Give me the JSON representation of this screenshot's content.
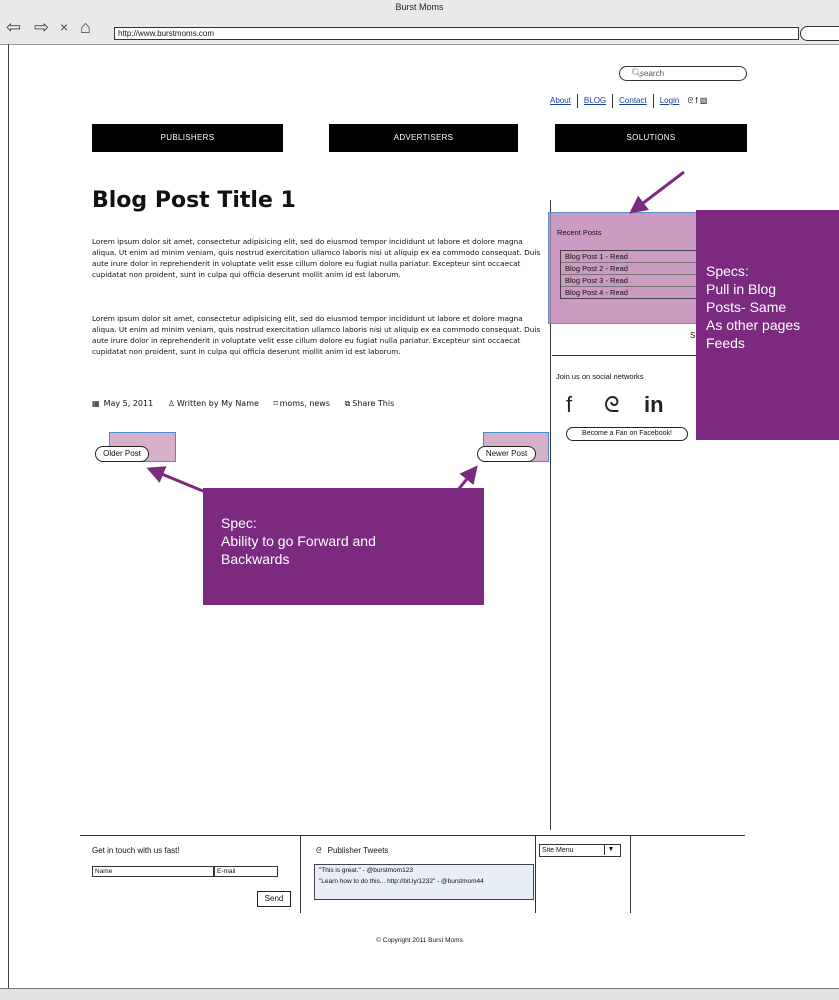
{
  "browser": {
    "window_title": "Burst Moms",
    "url": "http://www.burstmoms.com",
    "nav_back": "⇦",
    "nav_forward": "⇨",
    "nav_close": "×",
    "nav_home": "⌂"
  },
  "header": {
    "search_placeholder": "search",
    "links": {
      "about": "About",
      "blog": "BLOG",
      "contact": "Contact",
      "login": "Login"
    },
    "social_icons": [
      "twitter-icon",
      "facebook-icon",
      "rss-icon"
    ]
  },
  "nav": {
    "publishers": "PUBLISHERS",
    "advertisers": "ADVERTISERS",
    "solutions": "SOLUTIONS"
  },
  "post": {
    "title": "Blog Post Title 1",
    "paragraph1": "Lorem ipsum dolor sit amet, consectetur adipisicing elit, sed do eiusmod tempor incididunt ut labore et dolore magna aliqua. Ut enim ad minim veniam, quis nostrud exercitation ullamco laboris nisi ut aliquip ex ea commodo consequat. Duis aute irure dolor in reprehenderit in voluptate velit esse cillum dolore eu fugiat nulla pariatur. Excepteur sint occaecat cupidatat non proident, sunt in culpa qui officia deserunt mollit anim id est laborum.",
    "paragraph2": "Lorem ipsum dolor sit amet, consectetur adipisicing elit, sed do eiusmod tempor incididunt ut labore et dolore magna aliqua. Ut enim ad minim veniam, quis nostrud exercitation ullamco laboris nisi ut aliquip ex ea commodo consequat. Duis aute irure dolor in reprehenderit in voluptate velit esse cillum dolore eu fugiat nulla pariatur. Excepteur sint occaecat cupidatat non proident, sunt in culpa qui officia deserunt mollit anim id est laborum.",
    "date": "May 5, 2011",
    "author": "Written by My Name",
    "tags": "moms, news",
    "share": "Share This",
    "older": "Older Post",
    "newer": "Newer Post"
  },
  "sidebar": {
    "recent_title": "Recent Posts",
    "recent_posts": [
      "Blog Post 1 - Read",
      "Blog Post 2 - Read",
      "Blog Post 3 - Read",
      "Blog Post 4 - Read"
    ],
    "cut_letter": "S",
    "social_title": "Join us on social networks",
    "fan_button": "Become a Fan on Facebook!"
  },
  "specs": {
    "spec1": [
      "Specs:",
      "Pull in Blog",
      "Posts- Same",
      "As other pages",
      "Feeds"
    ],
    "spec2": [
      "Spec:",
      "Ability to go Forward and",
      "Backwards"
    ]
  },
  "footer": {
    "contact_title": "Get in touch with us fast!",
    "name_placeholder": "Name",
    "email_placeholder": "E-mail",
    "send": "Send",
    "tweets_title": "Publisher Tweets",
    "tweet1": "\"This is great.\" - @burstmom123",
    "tweet2": "\"Learn how to do this... http://bit.ly/1232\" - @burstmom44",
    "site_menu": "Site Menu",
    "copyright": "© Copyright 2011 Burst Moms"
  },
  "colors": {
    "spec_purple": "#7c2a7f",
    "highlight_pink": "#b46ea0",
    "nav_black": "#000000"
  }
}
